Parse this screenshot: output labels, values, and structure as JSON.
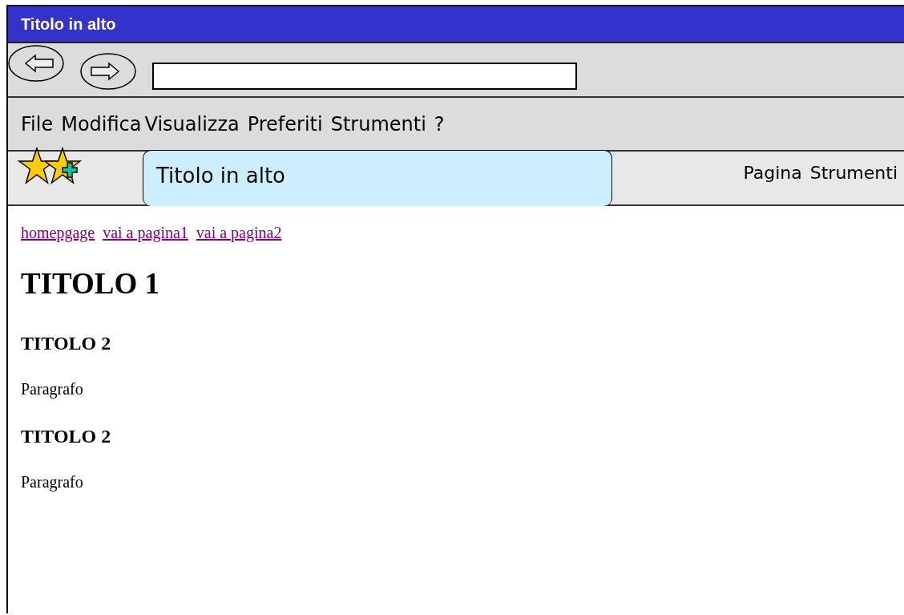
{
  "window": {
    "title": "Titolo in alto"
  },
  "menu": [
    "File",
    "Modifica",
    "Visualizza",
    "Preferiti",
    "Strumenti",
    "?"
  ],
  "tabs": [
    {
      "label": "Titolo in alto",
      "selected": true
    }
  ],
  "command_bar": [
    "Pagina",
    "Strumenti"
  ],
  "content": {
    "links": [
      "homepgage",
      "vai a pagina1",
      "vai a pagina2"
    ],
    "blocks": [
      {
        "kind": "h1",
        "text": "TITOLO 1"
      },
      {
        "kind": "h2",
        "text": "TITOLO 2"
      },
      {
        "kind": "p",
        "text": "Paragrafo"
      },
      {
        "kind": "h2",
        "text": "TITOLO 2"
      },
      {
        "kind": "p",
        "text": "Paragrafo"
      }
    ]
  }
}
